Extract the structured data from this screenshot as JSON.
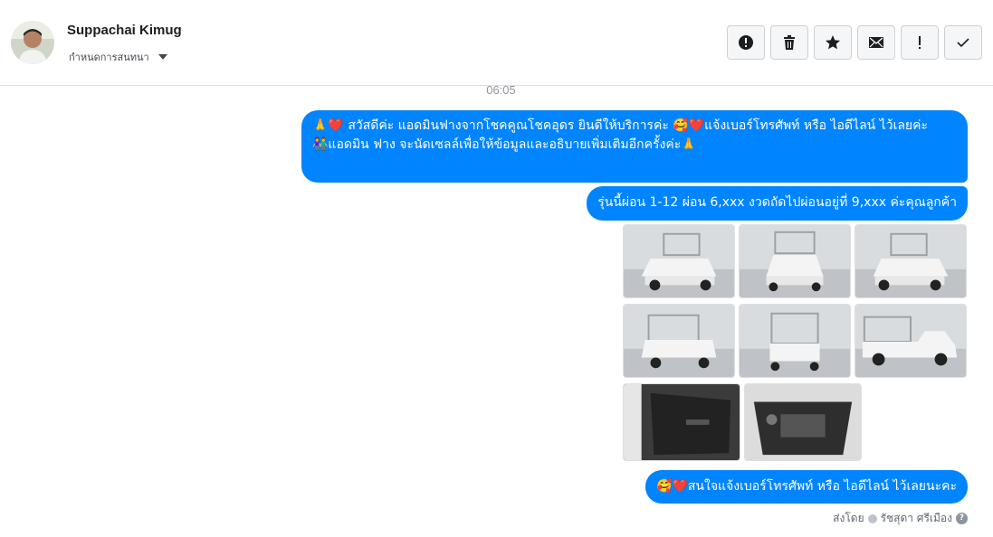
{
  "header": {
    "contact_name": "Suppachai Kimug",
    "label_dropdown": "กำหนดการสนทนา"
  },
  "toolbar": {
    "buttons": [
      {
        "name": "report-spam",
        "icon": "alert-circle-icon"
      },
      {
        "name": "delete",
        "icon": "trash-icon"
      },
      {
        "name": "star",
        "icon": "star-icon"
      },
      {
        "name": "mark-unread",
        "icon": "envelope-icon"
      },
      {
        "name": "important",
        "icon": "exclamation-icon"
      },
      {
        "name": "mark-done",
        "icon": "check-icon"
      }
    ]
  },
  "conversation": {
    "timestamp": "06:05",
    "messages": [
      {
        "line1": "🙏❤️ สวัสดีค่ะ แอดมินฟางจากโชคคูณโชคอุดร ยินดีให้บริการค่ะ  🥰❤️แจ้งเบอร์โทรศัพท์ หรือ ไอดีไลน์  ไว้เลยค่ะ",
        "line2": "👫แอดมิน ฟาง จะนัดเซลล์เพื่อให้ข้อมูลและอธิบายเพิ่มเติมอีกครั้งค่ะ🙏"
      },
      {
        "text": "รุ่นนี้ผ่อน 1-12 ผ่อน 6,xxx งวดถัดไปผ่อนอยู่ที่ 9,xxx ค่ะคุณลูกค้า"
      },
      {
        "text": "🥰❤️สนใจแจ้งเบอร์โทรศัพท์ หรือ ไอดีไลน์  ไว้เลยนะคะ"
      }
    ],
    "photos": [
      {
        "subject": "white pickup truck front-left view"
      },
      {
        "subject": "white pickup truck front view"
      },
      {
        "subject": "white pickup truck front-right view"
      },
      {
        "subject": "white pickup truck rear-left view"
      },
      {
        "subject": "white pickup truck rear view"
      },
      {
        "subject": "white pickup truck side view"
      },
      {
        "subject": "door interior panel"
      },
      {
        "subject": "engine bay"
      }
    ]
  },
  "footer": {
    "sent_by_label": "ส่งโดย",
    "sender_name": "รัชสุดา ศรีเมือง",
    "help_glyph": "?"
  },
  "colors": {
    "bubble": "#0084ff",
    "bubble_text": "#ffffff",
    "divider": "#dddfe2"
  }
}
